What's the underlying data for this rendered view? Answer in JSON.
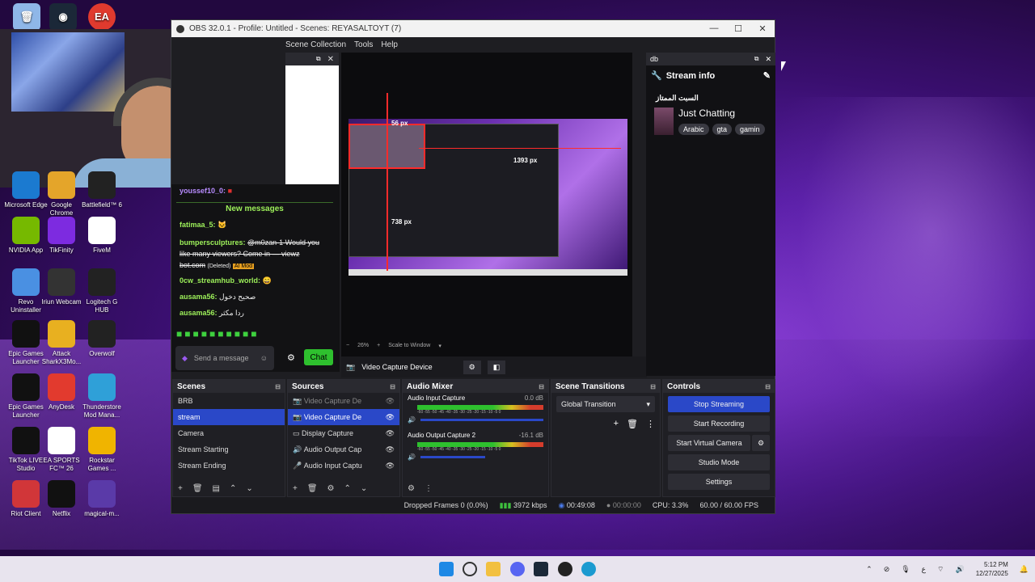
{
  "desktop": {
    "icons": [
      {
        "label": "Microsoft Edge",
        "color": "#1b7ad0"
      },
      {
        "label": "Google Chrome",
        "color": "#e4a52a"
      },
      {
        "label": "Battlefield™ 6",
        "color": "#222222"
      },
      {
        "label": "NVIDIA App",
        "color": "#76b900"
      },
      {
        "label": "TikFinity",
        "color": "#7d2be0"
      },
      {
        "label": "FiveM",
        "color": "#ffffff"
      },
      {
        "label": "Revo Uninstaller",
        "color": "#4a90e2"
      },
      {
        "label": "Iriun Webcam",
        "color": "#333333"
      },
      {
        "label": "Logitech G HUB",
        "color": "#222222"
      },
      {
        "label": "Epic Games Launcher",
        "color": "#111111"
      },
      {
        "label": "Attack SharkX3Mo...",
        "color": "#e8b020"
      },
      {
        "label": "Overwolf",
        "color": "#222222"
      },
      {
        "label": "Epic Games Launcher",
        "color": "#111111"
      },
      {
        "label": "AnyDesk",
        "color": "#e23a2e"
      },
      {
        "label": "Thunderstore Mod Mana...",
        "color": "#2fa0d8"
      },
      {
        "label": "TikTok LIVE Studio",
        "color": "#111111"
      },
      {
        "label": "EA SPORTS FC™ 26",
        "color": "#ffffff"
      },
      {
        "label": "Rockstar Games ...",
        "color": "#f0b400"
      },
      {
        "label": "Riot Client",
        "color": "#d13639"
      },
      {
        "label": "Netflix",
        "color": "#111111"
      },
      {
        "label": "magical-m...",
        "color": "#5a3aa8"
      }
    ]
  },
  "obs": {
    "title": "OBS 32.0.1 - Profile: Untitled - Scenes: REYASALTOYT (7)",
    "menu": [
      "Scene Collection",
      "Tools",
      "Help"
    ],
    "stream_info_dock": {
      "dock_title": "db",
      "heading": "Stream info",
      "channel_name": "السبت الممتاز",
      "category": "Just Chatting",
      "tags": [
        "Arabic",
        "gta",
        "gamin"
      ]
    },
    "chat": {
      "top_user": "youssef10_0:",
      "new_messages": "New messages",
      "messages": [
        {
          "user": "fatimaa_5:",
          "text": ""
        },
        {
          "user": "bumpersculptures:",
          "text": "@m0zan-1 Would you like many viewers? Come in — viewz bot.com",
          "deleted": "(Deleted)",
          "badge": "AI Mod"
        },
        {
          "user": "0cw_streamhub_world:",
          "text": ""
        },
        {
          "user": "ausama56:",
          "text": "صحيح دخول"
        },
        {
          "user": "ausama56:",
          "text": "ردا مكثر"
        }
      ],
      "placeholder": "Send a message",
      "chat_button": "Chat"
    },
    "preview": {
      "measure_top": "56 px",
      "measure_right": "1393 px",
      "measure_left": "738 px",
      "zoom": "26%",
      "scale_mode": "Scale to Window",
      "source_label": "Video Capture Device"
    },
    "scenes": {
      "title": "Scenes",
      "items": [
        "BRB",
        "stream",
        "Camera",
        "Stream Starting",
        "Stream Ending"
      ],
      "selected": "stream"
    },
    "sources": {
      "title": "Sources",
      "items": [
        "Video Capture De",
        "Video Capture De",
        "Display Capture",
        "Audio Output Cap",
        "Audio Input Captu"
      ]
    },
    "audio_mixer": {
      "title": "Audio Mixer",
      "channels": [
        {
          "name": "Audio Input Capture",
          "db": "0.0 dB"
        },
        {
          "name": "Audio Output Capture 2",
          "db": "-16.1 dB"
        }
      ],
      "scale": "-60 -55 -50 -45 -40 -35 -30 -25 -20 -15 -10 -5 0"
    },
    "transitions": {
      "title": "Scene Transitions",
      "selected": "Global Transition"
    },
    "controls": {
      "title": "Controls",
      "buttons": [
        "Stop Streaming",
        "Start Recording",
        "Start Virtual Camera",
        "Studio Mode",
        "Settings"
      ]
    },
    "status": {
      "dropped": "Dropped Frames 0 (0.0%)",
      "bitrate": "3972 kbps",
      "stream_time": "00:49:08",
      "rec_time": "00:00:00",
      "cpu": "CPU: 3.3%",
      "fps": "60.00 / 60.00 FPS"
    }
  },
  "taskbar": {
    "time": "5:12 PM",
    "date": "12/27/2025",
    "lang": "ع"
  }
}
